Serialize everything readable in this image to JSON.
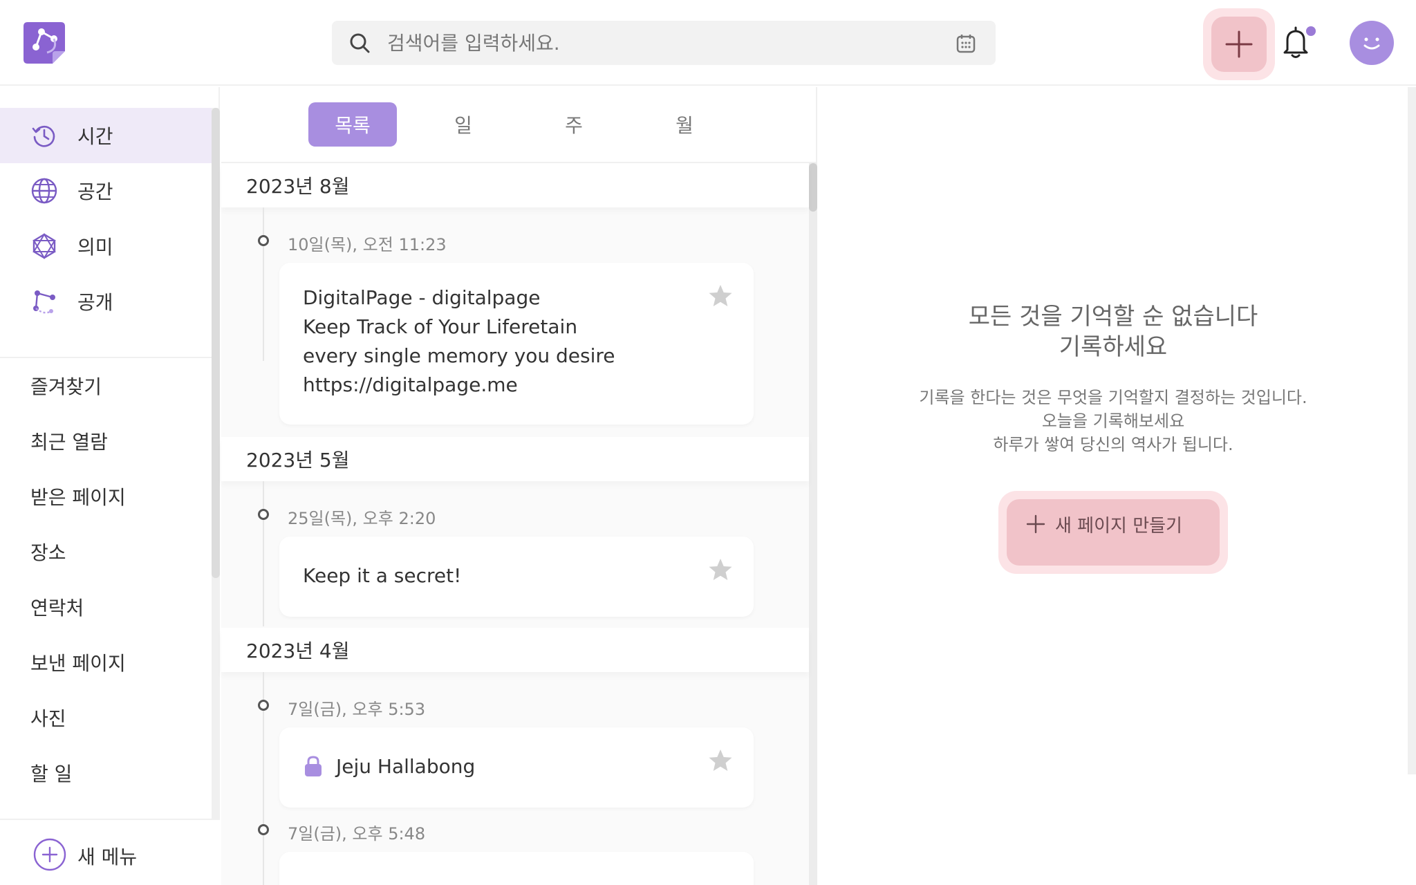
{
  "search": {
    "placeholder": "검색어를 입력하세요."
  },
  "sidebar": {
    "primary": [
      {
        "label": "시간",
        "icon": "clock-history-icon",
        "active": true
      },
      {
        "label": "공간",
        "icon": "globe-icon",
        "active": false
      },
      {
        "label": "의미",
        "icon": "network-icon",
        "active": false
      },
      {
        "label": "공개",
        "icon": "share-icon",
        "active": false
      }
    ],
    "menu": [
      "즐겨찾기",
      "최근 열람",
      "받은 페이지",
      "장소",
      "연락처",
      "보낸 페이지",
      "사진",
      "할 일"
    ],
    "new_menu_label": "새 메뉴"
  },
  "tabs": [
    "목록",
    "일",
    "주",
    "월"
  ],
  "timeline": {
    "groups": [
      {
        "month": "2023년 8월",
        "entries": [
          {
            "date": "10일(목), 오전 11:23",
            "text": "DigitalPage - digitalpage\nKeep Track of Your Liferetain\nevery single memory you desire\nhttps://digitalpage.me",
            "locked": false
          }
        ]
      },
      {
        "month": "2023년 5월",
        "entries": [
          {
            "date": "25일(목), 오후 2:20",
            "text": "Keep it a secret!",
            "locked": false
          }
        ]
      },
      {
        "month": "2023년 4월",
        "entries": [
          {
            "date": "7일(금), 오후 5:53",
            "text": "Jeju Hallabong",
            "locked": true
          },
          {
            "date": "7일(금), 오후 5:48",
            "text": "",
            "locked": false
          }
        ]
      }
    ]
  },
  "empty_state": {
    "title_line1": "모든 것을 기억할 순 없습니다",
    "title_line2": "기록하세요",
    "desc_line1": "기록을 한다는 것은 무엇을 기억할지 결정하는 것입니다.",
    "desc_line2": "오늘을 기록해보세요",
    "desc_line3": "하루가 쌓여 당신의 역사가 됩니다.",
    "create_label": "새 페이지 만들기"
  },
  "colors": {
    "accent": "#a88ee0",
    "pink": "#f1c3c9",
    "pink_light": "#fce3e6",
    "active_bg": "#efeaf8"
  }
}
